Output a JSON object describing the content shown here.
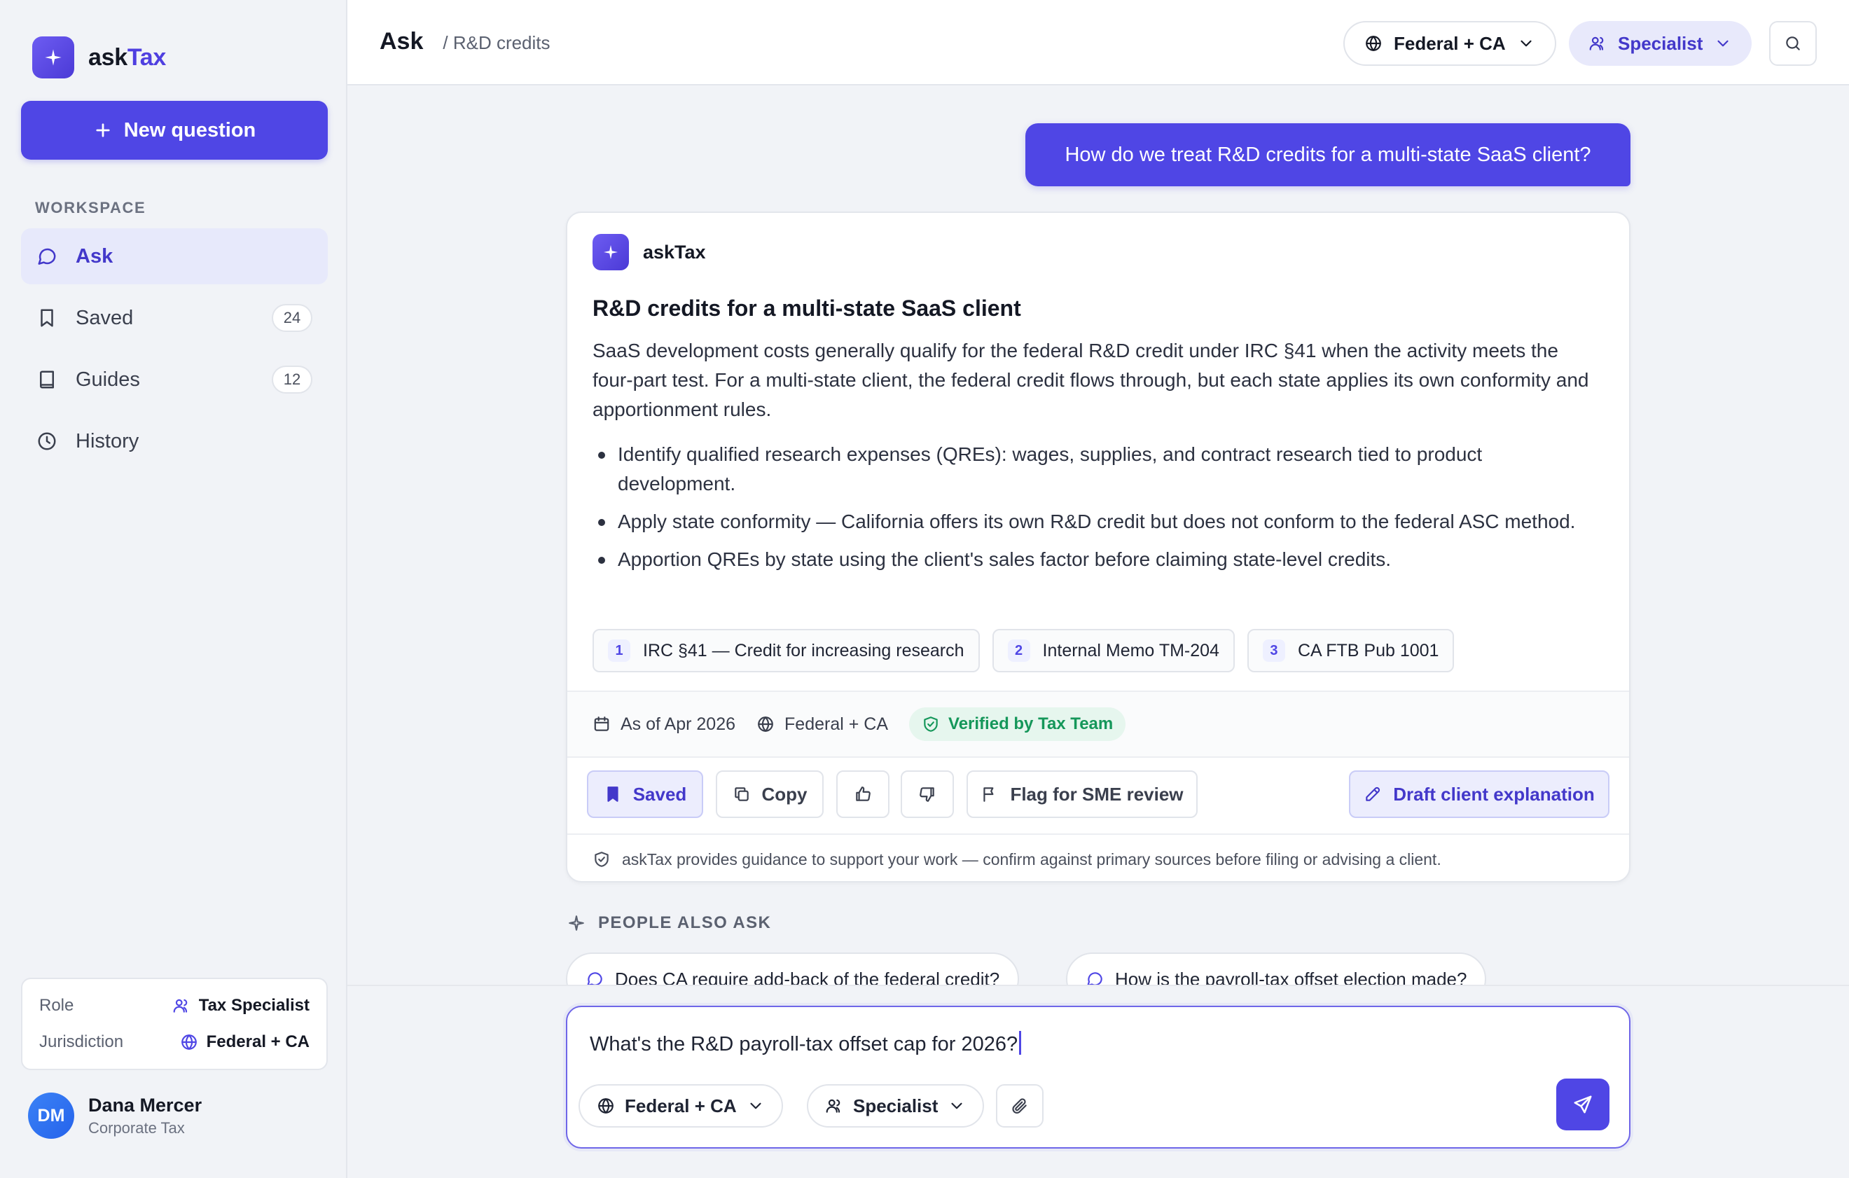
{
  "app": {
    "brand_prefix": "ask",
    "brand_accent": "Tax",
    "accent_color": "#4f46e5"
  },
  "sidebar": {
    "new_question": "New question",
    "section_label": "WORKSPACE",
    "items": [
      {
        "label": "Ask",
        "icon": "chat-bubble-icon",
        "count": null,
        "active": true
      },
      {
        "label": "Saved",
        "icon": "bookmark-icon",
        "count": "24"
      },
      {
        "label": "Guides",
        "icon": "book-icon",
        "count": "12"
      },
      {
        "label": "History",
        "icon": "clock-icon",
        "count": null
      }
    ],
    "context": {
      "role_label": "Role",
      "role_value": "Tax Specialist",
      "jurisdiction_label": "Jurisdiction",
      "jurisdiction_value": "Federal + CA"
    },
    "user": {
      "initials": "DM",
      "name": "Dana Mercer",
      "team": "Corporate Tax"
    }
  },
  "header": {
    "title": "Ask",
    "breadcrumb": "/ R&D credits",
    "jurisdiction": "Federal + CA",
    "role": "Specialist"
  },
  "conversation": {
    "user_message": "How do we treat R&D credits for a multi-state SaaS client?",
    "answer": {
      "author": "askTax",
      "title": "R&D credits for a multi-state SaaS client",
      "body": "SaaS development costs generally qualify for the federal R&D credit under IRC §41 when the activity meets the four-part test. For a multi-state client, the federal credit flows through, but each state applies its own conformity and apportionment rules.",
      "bullets": [
        "Identify qualified research expenses (QREs): wages, supplies, and contract research tied to product development.",
        "Apply state conformity — California offers its own R&D credit but does not conform to the federal ASC method.",
        "Apportion QREs by state using the client's sales factor before claiming state-level credits."
      ],
      "sources": [
        {
          "n": "1",
          "label": "IRC §41 — Credit for increasing research"
        },
        {
          "n": "2",
          "label": "Internal Memo TM-204"
        },
        {
          "n": "3",
          "label": "CA FTB Pub 1001"
        }
      ],
      "meta": {
        "as_of": "As of Apr 2026",
        "jurisdiction": "Federal + CA",
        "verified": "Verified by Tax Team"
      },
      "actions": {
        "saved": "Saved",
        "copy": "Copy",
        "flag": "Flag for SME review",
        "draft": "Draft client explanation"
      },
      "disclaimer": "askTax provides guidance to support your work — confirm against primary sources before filing or advising a client."
    }
  },
  "people_also_ask": {
    "label": "PEOPLE ALSO ASK",
    "items": [
      "Does CA require add-back of the federal credit?",
      "How is the payroll-tax offset election made?"
    ]
  },
  "composer": {
    "value": "What's the R&D payroll-tax offset cap for 2026?",
    "jurisdiction": "Federal + CA",
    "role": "Specialist"
  }
}
